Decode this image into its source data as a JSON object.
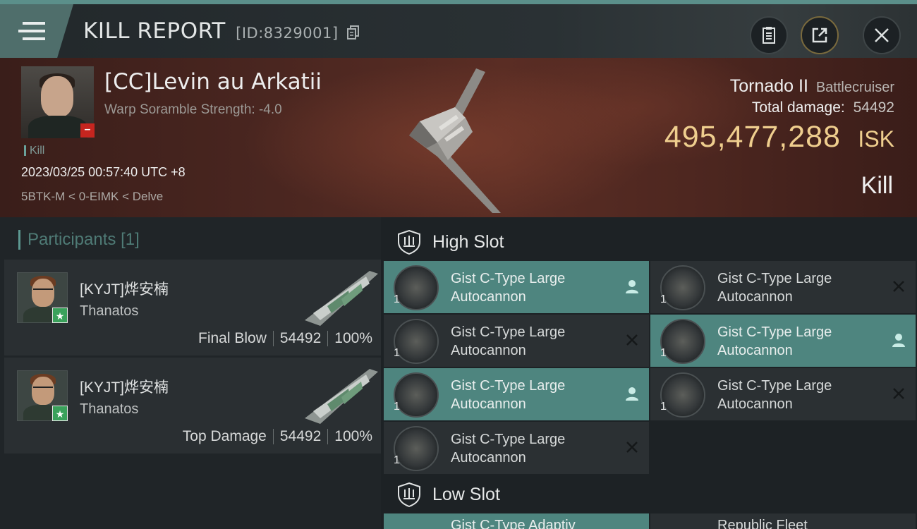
{
  "header": {
    "title": "KILL REPORT",
    "report_id": "[ID:8329001]"
  },
  "victim": {
    "name": "[CC]Levin au Arkatii",
    "warp_scramble": "Warp Soramble Strength: -4.0",
    "tag": "Kill",
    "datetime": "2023/03/25 00:57:40 UTC +8",
    "location": "5BTK-M < 0-EIMK < Delve"
  },
  "ship": {
    "name": "Tornado II",
    "class": "Battlecruiser",
    "total_damage_label": "Total damage:",
    "total_damage": "54492",
    "isk_value": "495,477,288",
    "isk_unit": "ISK",
    "result": "Kill"
  },
  "participants": {
    "label": "Participants",
    "count": "[1]",
    "rows": [
      {
        "name": "[KYJT]烨安楠",
        "ship": "Thanatos",
        "role": "Final Blow",
        "damage": "54492",
        "percent": "100%"
      },
      {
        "name": "[KYJT]烨安楠",
        "ship": "Thanatos",
        "role": "Top Damage",
        "damage": "54492",
        "percent": "100%"
      }
    ]
  },
  "slots": {
    "high_label": "High Slot",
    "low_label": "Low Slot",
    "high_modules": [
      {
        "line1": "Gist C-Type Large",
        "line2": "Autocannon",
        "qty": "1",
        "status": "dropped"
      },
      {
        "line1": "Gist C-Type Large",
        "line2": "Autocannon",
        "qty": "1",
        "status": "destroyed"
      },
      {
        "line1": "Gist C-Type Large",
        "line2": "Autocannon",
        "qty": "1",
        "status": "destroyed"
      },
      {
        "line1": "Gist C-Type Large",
        "line2": "Autocannon",
        "qty": "1",
        "status": "dropped"
      },
      {
        "line1": "Gist C-Type Large",
        "line2": "Autocannon",
        "qty": "1",
        "status": "dropped"
      },
      {
        "line1": "Gist C-Type Large",
        "line2": "Autocannon",
        "qty": "1",
        "status": "destroyed"
      },
      {
        "line1": "Gist C-Type Large",
        "line2": "Autocannon",
        "qty": "1",
        "status": "destroyed"
      }
    ],
    "low_partial": [
      {
        "text": "Gist C-Type Adaptiv"
      },
      {
        "text": "Republic Fleet"
      }
    ]
  },
  "colors": {
    "accent": "#5b8f8a",
    "active_module": "#4e857f",
    "isk_gold": "#efce8e",
    "negative_badge": "#c6251f",
    "positive_badge": "#3aa15b"
  },
  "icons": {
    "menu": "hamburger-menu-icon",
    "copy": "copy-icon",
    "clipboard": "clipboard-icon",
    "share": "share-icon",
    "close": "close-icon",
    "slot": "shield-icon",
    "dropped": "person-icon",
    "destroyed": "x-icon"
  }
}
